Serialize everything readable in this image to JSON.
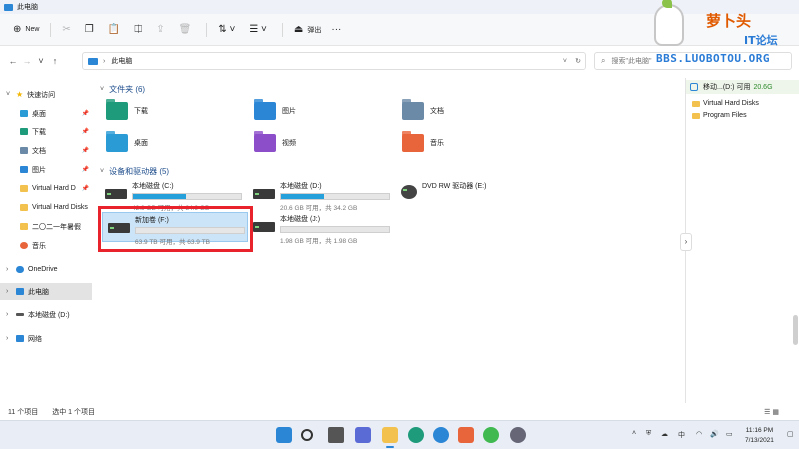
{
  "window": {
    "title": "此电脑"
  },
  "toolbar": {
    "new_label": "New",
    "eject_label": "弹出"
  },
  "address": {
    "location": "此电脑"
  },
  "search": {
    "placeholder": "搜索\"此电脑\""
  },
  "sidebar": {
    "items": [
      {
        "label": "快速访问",
        "color": "#f2b600"
      },
      {
        "label": "桌面",
        "color": "#2b9bd6"
      },
      {
        "label": "下载",
        "color": "#1e9b7a"
      },
      {
        "label": "文档",
        "color": "#6b8aa8"
      },
      {
        "label": "图片",
        "color": "#2b86d6"
      },
      {
        "label": "Virtual Hard D",
        "color": "#f2c14e"
      },
      {
        "label": "Virtual Hard Disks",
        "color": "#f2c14e"
      },
      {
        "label": "二〇二一年暑假",
        "color": "#f2c14e"
      },
      {
        "label": "音乐",
        "color": "#e8643a"
      },
      {
        "label": "OneDrive",
        "color": "#2b86d6"
      },
      {
        "label": "此电脑",
        "color": "#2b86d6"
      },
      {
        "label": "本地磁盘 (D:)",
        "color": "#555555"
      },
      {
        "label": "网络",
        "color": "#2b86d6"
      }
    ]
  },
  "folders_section": {
    "title": "文件夹 (6)",
    "items": [
      {
        "label": "下载",
        "color": "#1e9b7a"
      },
      {
        "label": "图片",
        "color": "#2b86d6"
      },
      {
        "label": "文档",
        "color": "#6b8aa8"
      },
      {
        "label": "桌面",
        "color": "#2b9bd6"
      },
      {
        "label": "视频",
        "color": "#8d4fc9"
      },
      {
        "label": "音乐",
        "color": "#e8643a"
      }
    ]
  },
  "drives_section": {
    "title": "设备和驱动器 (5)",
    "items": [
      {
        "name": "本地磁盘 (C:)",
        "info": "42.9 GB 可用，共 84.9 GB",
        "used": 0.49
      },
      {
        "name": "本地磁盘 (D:)",
        "info": "20.6 GB 可用，共 34.2 GB",
        "used": 0.4
      },
      {
        "name": "DVD RW 驱动器 (E:)",
        "info": ""
      },
      {
        "name": "新加卷 (F:)",
        "info": "63.9 TB 可用，共 63.9 TB",
        "used": 0.0
      },
      {
        "name": "本地磁盘 (J:)",
        "info": "1.98 GB 可用，共 1.98 GB",
        "used": 0.0
      }
    ]
  },
  "preview": {
    "drive_label": "移动...(D:) 可用",
    "free": "20.6G",
    "items": [
      "Virtual Hard Disks",
      "Program Files"
    ]
  },
  "status": {
    "count": "11 个项目",
    "selected": "选中 1 个项目"
  },
  "clock": {
    "time": "11:16 PM",
    "date": "7/13/2021"
  },
  "tray": {
    "lang": "中"
  },
  "watermark": {
    "line1": "萝卜头",
    "line2": "IT论坛",
    "line3": "BBS.LUOBOTOU.ORG"
  }
}
